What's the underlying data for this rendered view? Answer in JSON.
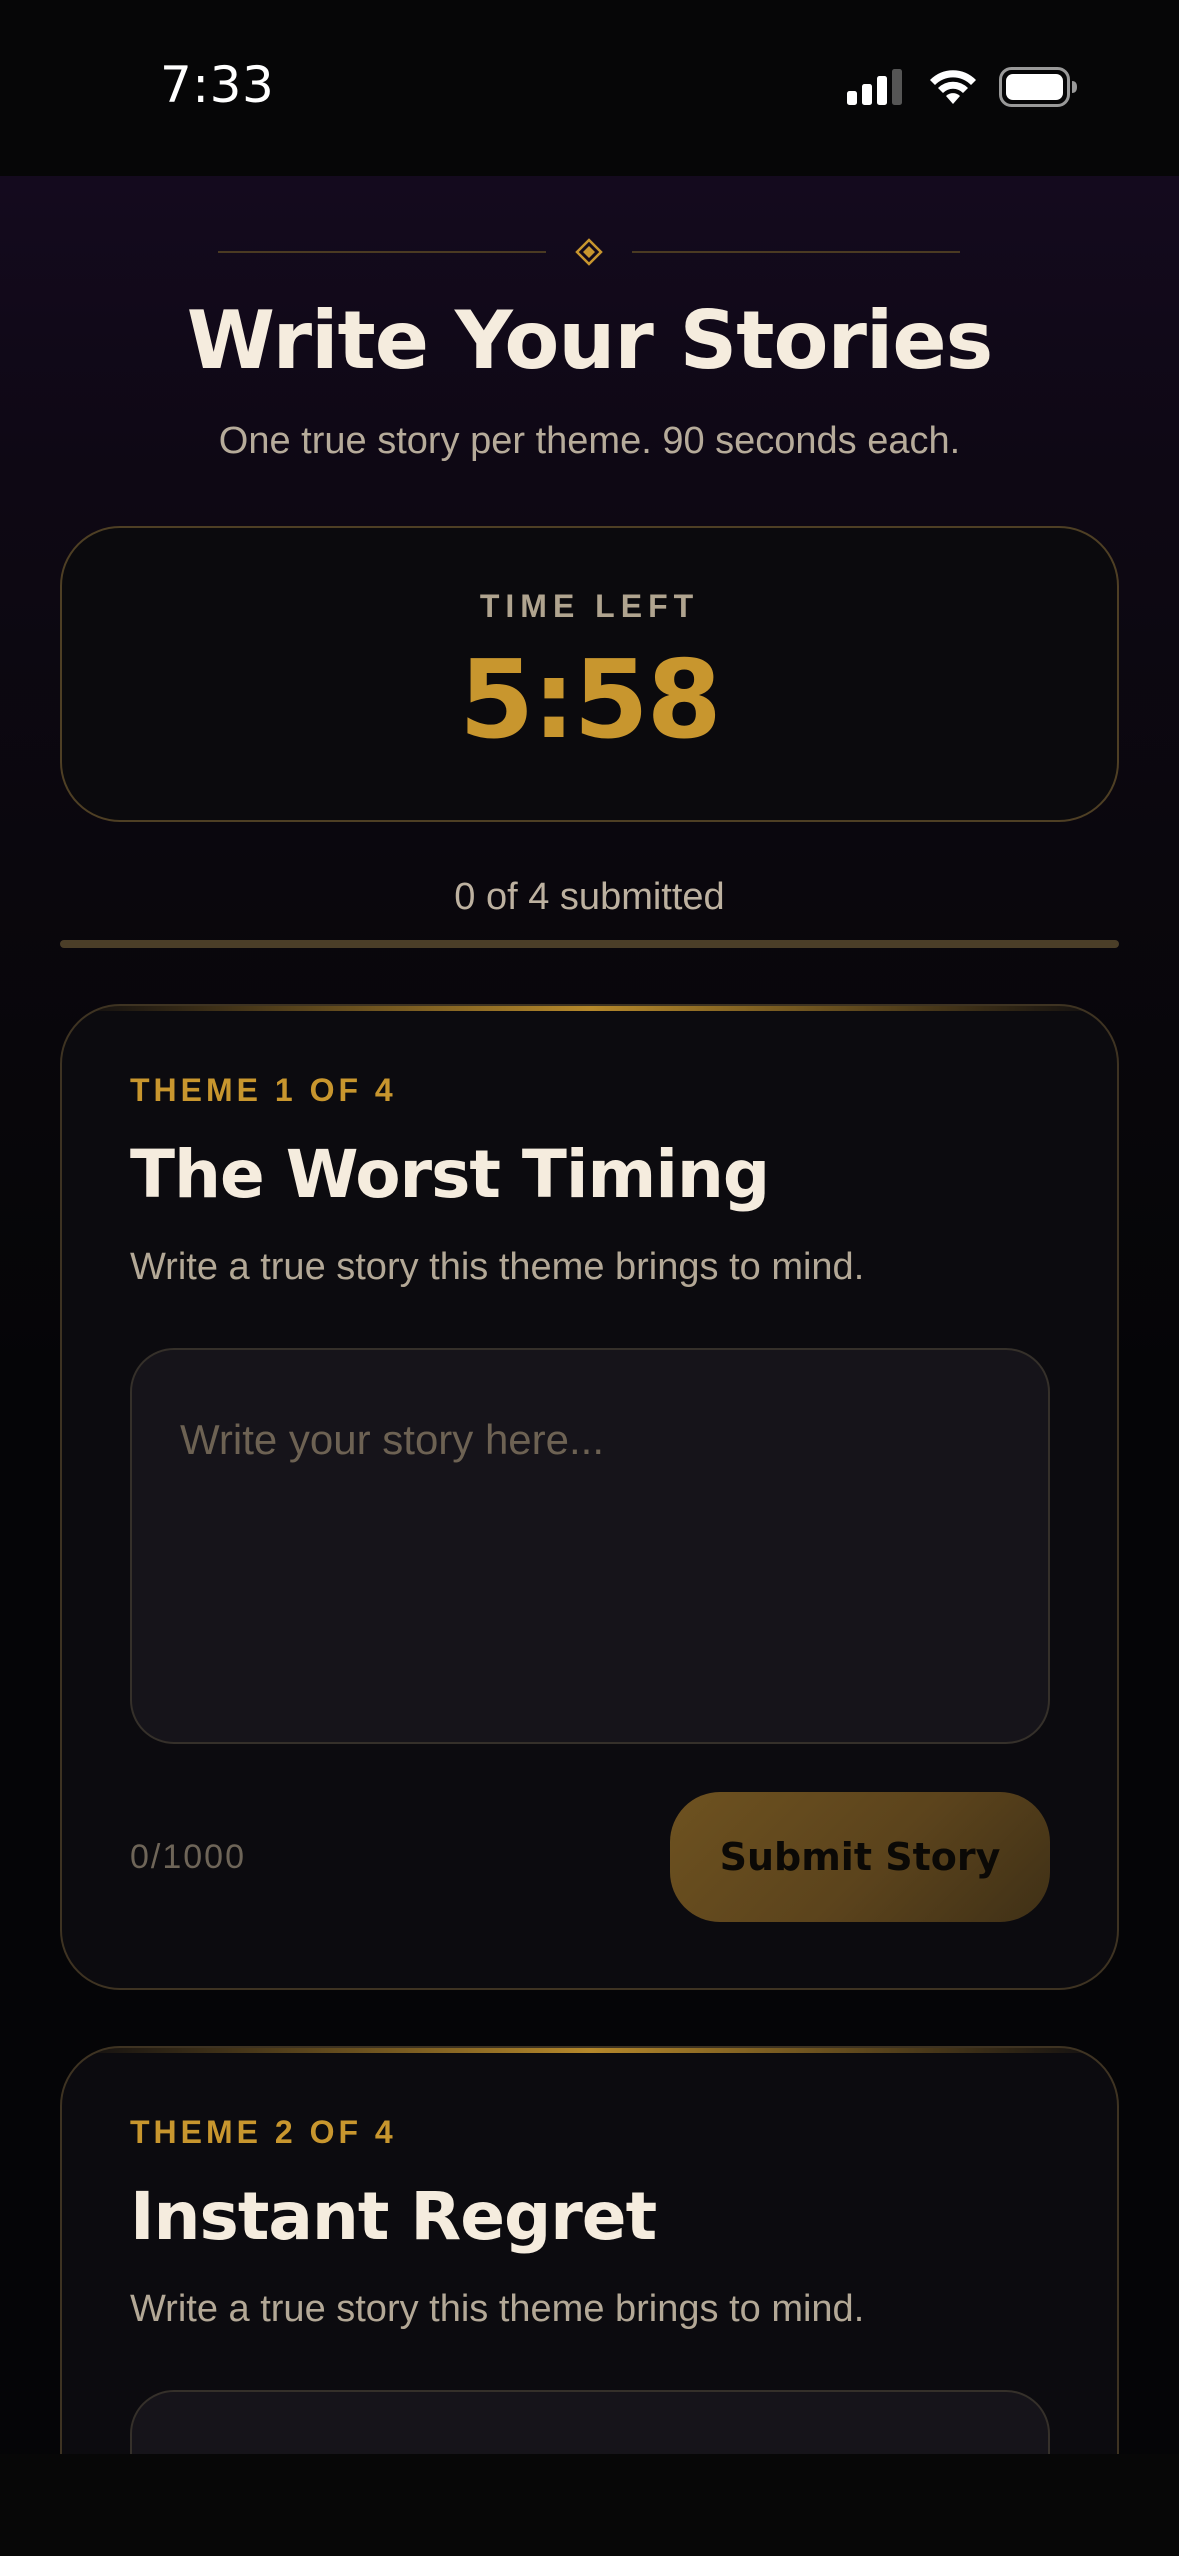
{
  "status_bar": {
    "time": "7:33"
  },
  "header": {
    "title": "Write Your Stories",
    "subtitle": "One true story per theme. 90 seconds each."
  },
  "timer": {
    "label": "TIME LEFT",
    "value": "5:58"
  },
  "progress": {
    "text": "0 of 4 submitted",
    "submitted": 0,
    "total": 4
  },
  "themes": [
    {
      "kicker": "THEME 1 OF 4",
      "title": "The Worst Timing",
      "prompt": "Write a true story this theme brings to mind.",
      "placeholder": "Write your story here...",
      "char_count": "0/1000",
      "submit_label": "Submit Story"
    },
    {
      "kicker": "THEME 2 OF 4",
      "title": "Instant Regret",
      "prompt": "Write a true story this theme brings to mind."
    }
  ],
  "colors": {
    "accent": "#c8962e",
    "background": "#0a070d",
    "text": "#f5ecde"
  }
}
